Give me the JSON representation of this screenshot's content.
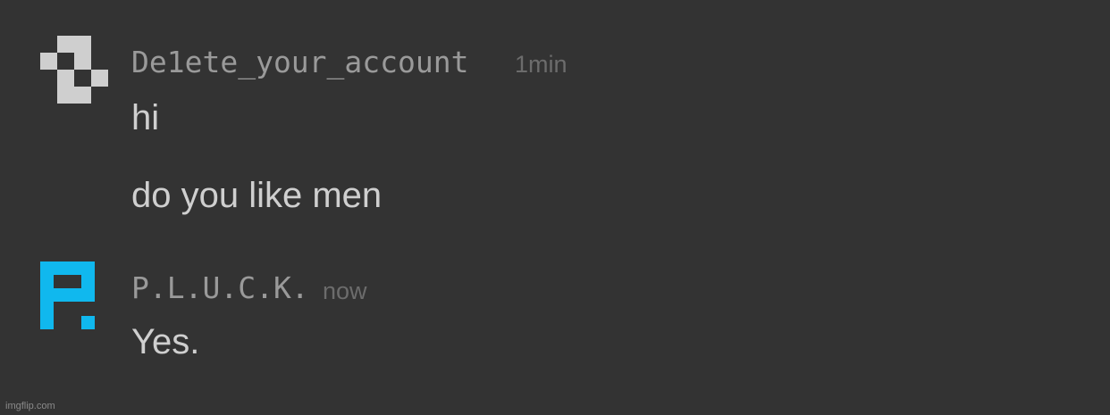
{
  "messages": [
    {
      "username": "De1ete_your_account",
      "timestamp": "1min",
      "avatar_icon": "gray-pixel-pattern-avatar-icon",
      "avatar_color": "#cfcfcf",
      "lines": [
        "hi",
        "do you like men"
      ]
    },
    {
      "username": "P.L.U.C.K.",
      "timestamp": "now",
      "avatar_icon": "blue-pixel-letter-p-avatar-icon",
      "avatar_color": "#10b8ee",
      "lines": [
        "Yes."
      ]
    }
  ],
  "colors": {
    "background": "#333333",
    "username": "#9a9a9a",
    "timestamp": "#6c6c6c",
    "message_text": "#cfcfcf"
  },
  "watermark": "imgflip.com"
}
